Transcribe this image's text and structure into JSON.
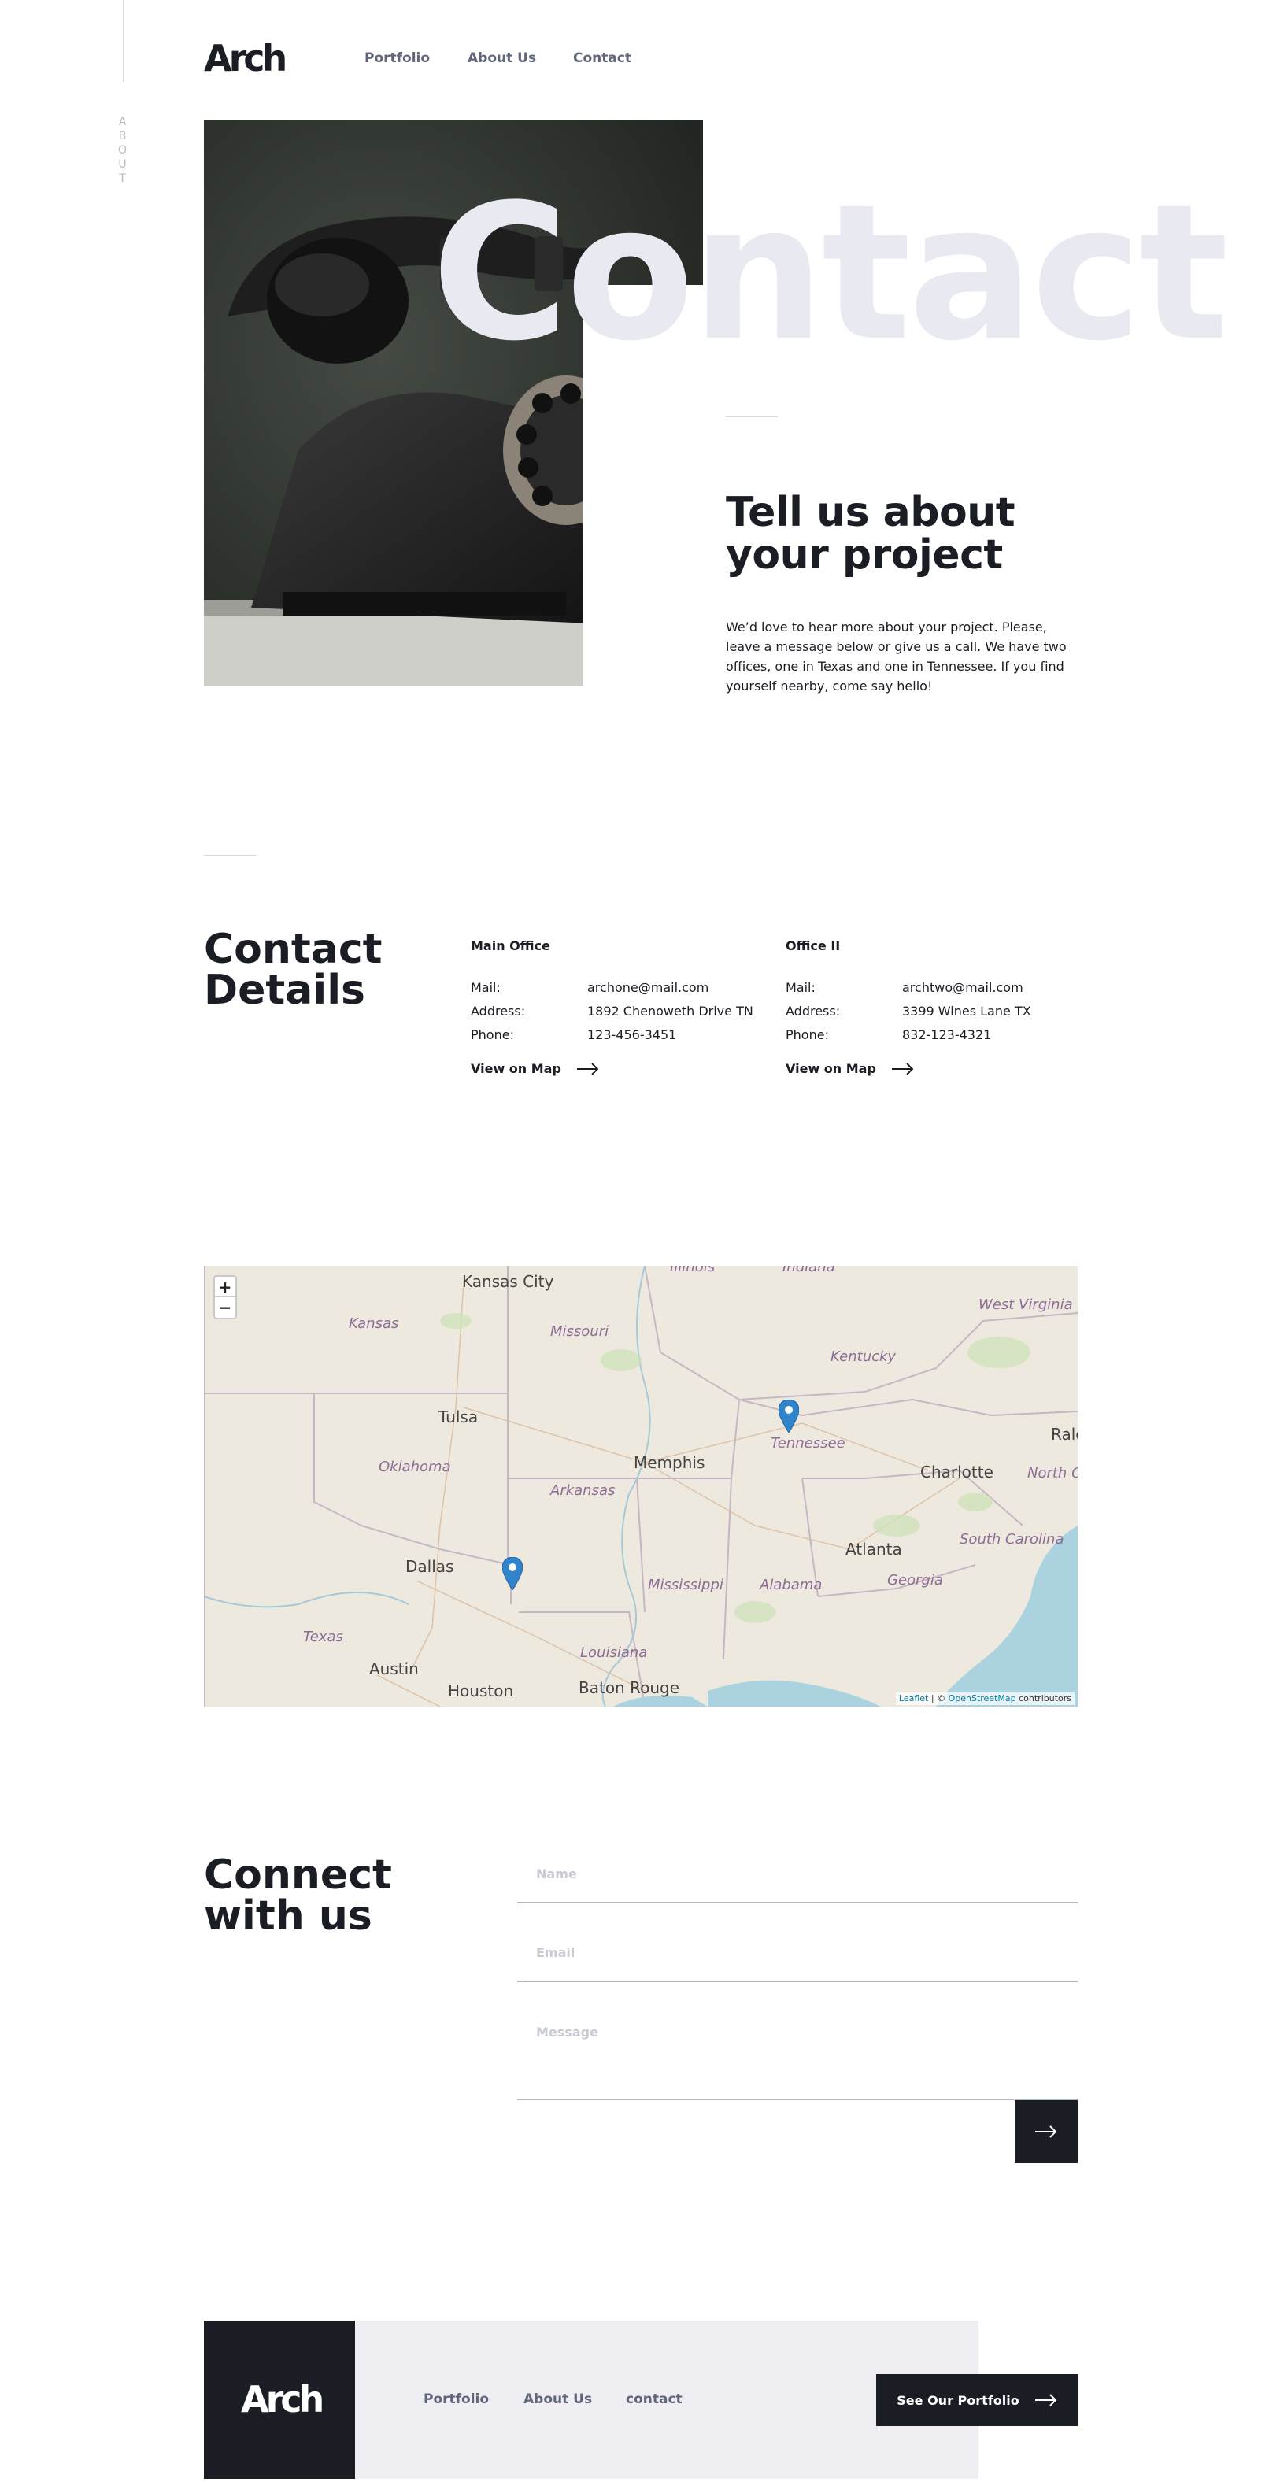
{
  "side": {
    "label_letters": [
      "A",
      "B",
      "O",
      "U",
      "T"
    ]
  },
  "header": {
    "logo": "Arch",
    "nav": [
      "Portfolio",
      "About Us",
      "Contact"
    ]
  },
  "hero": {
    "bg_word": "Contact",
    "title_line1": "Tell us about",
    "title_line2": "your project",
    "description": "We’d love to hear more about your project. Please, leave a message below or give us a call. We have two offices, one in Texas and one in Tennessee. If you find yourself nearby, come say hello!"
  },
  "contact_details": {
    "title_line1": "Contact",
    "title_line2": "Details",
    "offices": [
      {
        "name": "Main Office",
        "mail_label": "Mail:",
        "mail": "archone@mail.com",
        "address_label": "Address:",
        "address": "1892 Chenoweth Drive TN",
        "phone_label": "Phone:",
        "phone": "123-456-3451",
        "map_link": "View on Map"
      },
      {
        "name": "Office II",
        "mail_label": "Mail:",
        "mail": "archtwo@mail.com",
        "address_label": "Address:",
        "address": "3399 Wines Lane TX",
        "phone_label": "Phone:",
        "phone": "832-123-4321",
        "map_link": "View on Map"
      }
    ]
  },
  "map": {
    "zoom_in": "+",
    "zoom_out": "−",
    "cities": [
      "Kansas City",
      "Tulsa",
      "Memphis",
      "Charlotte",
      "Raleigh",
      "Atlanta",
      "Dallas",
      "Austin",
      "Houston",
      "Baton Rouge"
    ],
    "states": [
      "Illinois",
      "Indiana",
      "Kansas",
      "Missouri",
      "West Virginia",
      "Kentucky",
      "Oklahoma",
      "Tennessee",
      "Arkansas",
      "North Ca",
      "South Carolina",
      "Georgia",
      "Mississippi",
      "Alabama",
      "Texas",
      "Louisiana"
    ],
    "attribution_leaflet": "Leaflet",
    "attribution_sep": " | © ",
    "attribution_osm": "OpenStreetMap",
    "attribution_rest": " contributors",
    "marker_color": "#2f84cb"
  },
  "connect": {
    "title_line1": "Connect",
    "title_line2": "with us",
    "name_placeholder": "Name",
    "email_placeholder": "Email",
    "message_placeholder": "Message"
  },
  "footer": {
    "logo": "Arch",
    "nav": [
      "Portfolio",
      "About Us",
      "contact"
    ],
    "cta": "See Our Portfolio"
  },
  "colors": {
    "dark": "#1b1d24",
    "nav_text": "#60667a",
    "bg_word": "#e9eaf1",
    "footer_bg": "#eeeef3",
    "water": "#aad3df"
  }
}
